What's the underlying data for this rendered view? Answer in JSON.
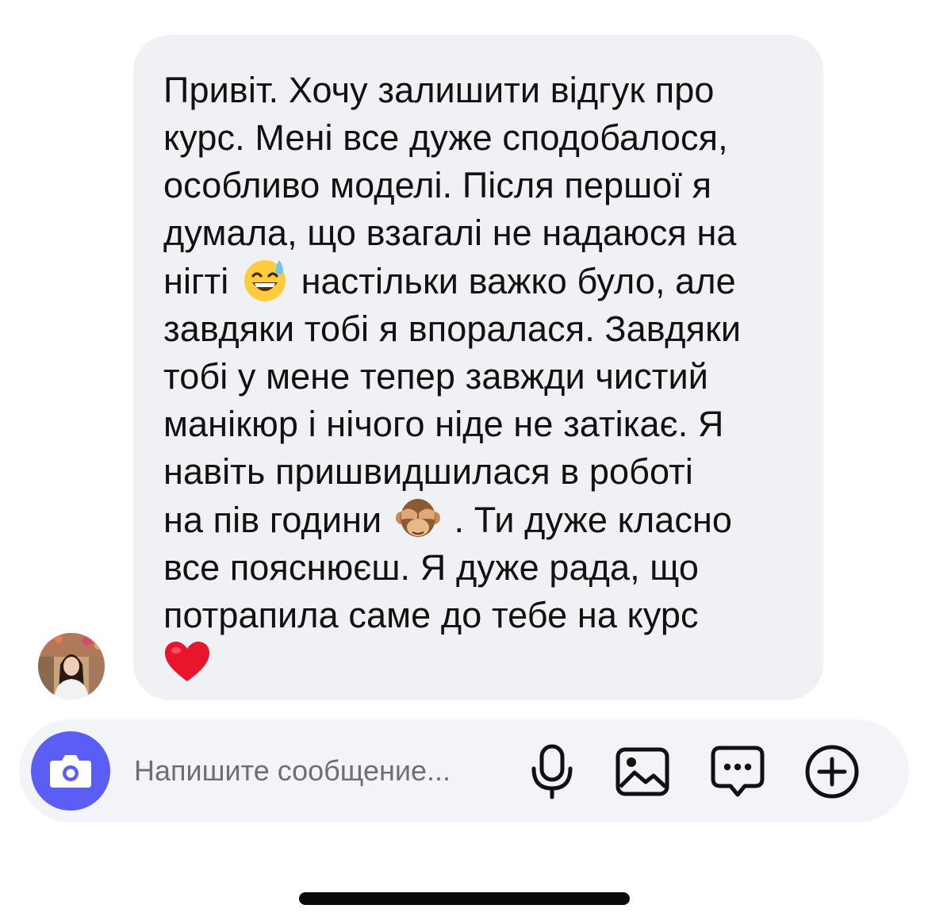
{
  "message": {
    "lines": [
      "Привіт. Хочу залишити відгук про",
      "курс. Мені все дуже сподобалося,",
      "особливо моделі. Після першої я",
      "думала, що взагалі не надаюся на",
      "нігті",
      "настільки важко було, але",
      "завдяки тобі я впоралася. Завдяки",
      "тобі у мене тепер завжди чистий",
      "манікюр і нічого ніде не затікає. Я",
      "навіть пришвидшилася в роботі",
      "на пів години",
      ". Ти дуже класно",
      "все пояснюєш. Я дуже рада, що",
      "потрапила саме до тебе на курс"
    ],
    "emojis": {
      "sweat_smile": "sweat-smile-emoji",
      "see_no_evil": "see-no-evil-monkey-emoji",
      "heart": "red-heart-emoji"
    }
  },
  "composer": {
    "placeholder": "Напишите сообщение...",
    "icons": [
      "camera-icon",
      "microphone-icon",
      "gallery-icon",
      "sticker-icon",
      "plus-icon"
    ]
  },
  "colors": {
    "bubble_bg": "#eff1f5",
    "composer_bg": "#f3f4f7",
    "accent": "#5a5ef5",
    "text": "#111111",
    "placeholder": "#6e6f74"
  }
}
